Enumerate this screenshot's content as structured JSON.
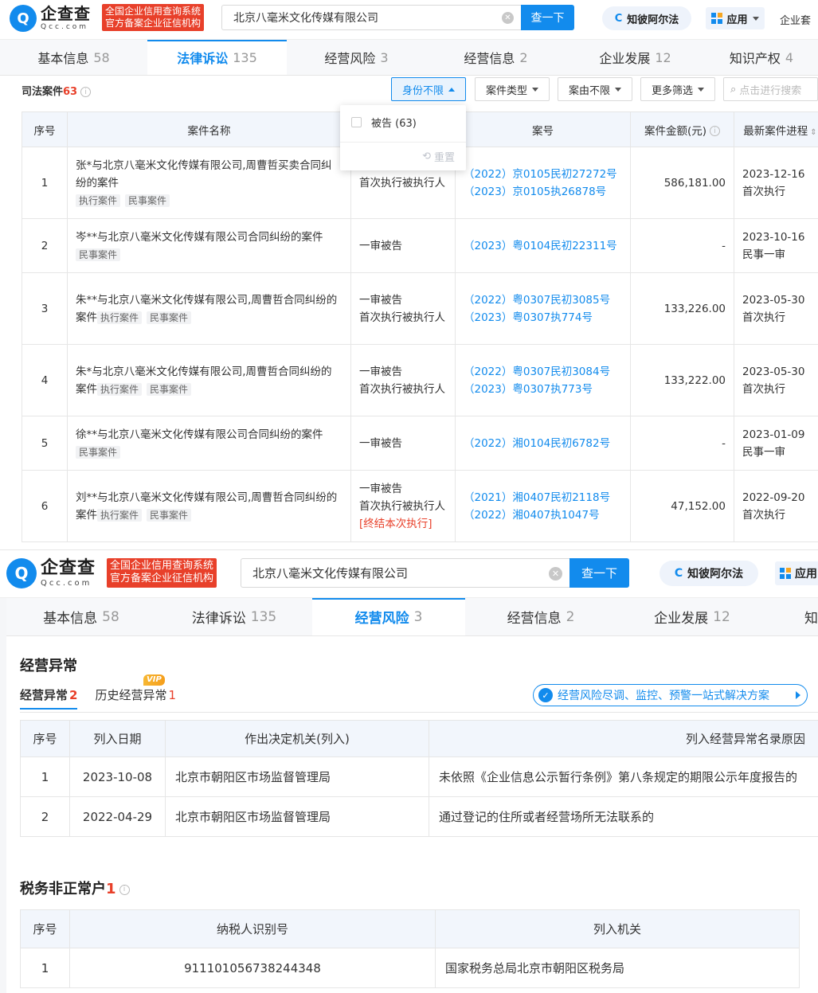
{
  "header": {
    "logo_cn": "企查查",
    "logo_en": "Qcc.com",
    "badge_line1": "全国企业信用查询系统",
    "badge_line2": "官方备案企业征信机构",
    "search_value": "北京八毫米文化传媒有限公司",
    "search_button": "查一下",
    "assistant_label": "知彼阿尔法",
    "app_label": "应用",
    "more_label": "企业套"
  },
  "tabs1": [
    {
      "label": "基本信息",
      "count": "58"
    },
    {
      "label": "法律诉讼",
      "count": "135"
    },
    {
      "label": "经营风险",
      "count": "3"
    },
    {
      "label": "经营信息",
      "count": "2"
    },
    {
      "label": "企业发展",
      "count": "12"
    },
    {
      "label": "知识产权",
      "count": "4"
    }
  ],
  "tabs2": [
    {
      "label": "基本信息",
      "count": "58"
    },
    {
      "label": "法律诉讼",
      "count": "135"
    },
    {
      "label": "经营风险",
      "count": "3"
    },
    {
      "label": "经营信息",
      "count": "2"
    },
    {
      "label": "企业发展",
      "count": "12"
    },
    {
      "label": "知",
      "count": ""
    }
  ],
  "judicial": {
    "title": "司法案件",
    "count": "63",
    "filters": [
      "身份不限",
      "案件类型",
      "案由不限",
      "更多筛选"
    ],
    "search_placeholder": "点击进行搜索",
    "popup": {
      "option": "被告 (63)",
      "reset": "重置"
    },
    "columns": [
      "序号",
      "案件名称",
      "",
      "案号",
      "案件金额(元)",
      "最新案件进程"
    ],
    "rows": [
      {
        "no": "1",
        "name": "张*与北京八毫米文化传媒有限公司,周曹哲买卖合同纠纷的案件",
        "tags": [
          "执行案件",
          "民事案件"
        ],
        "roles": [
          "",
          "首次执行被执行人"
        ],
        "role_note": "",
        "case_nos": [
          "（2022）京0105民初27272号",
          "（2023）京0105执26878号"
        ],
        "amount": "586,181.00",
        "date": "2023-12-16",
        "stage": "首次执行"
      },
      {
        "no": "2",
        "name": "岑**与北京八毫米文化传媒有限公司合同纠纷的案件",
        "tags": [
          "民事案件"
        ],
        "roles": [
          "一审被告"
        ],
        "role_note": "",
        "case_nos": [
          "（2023）粤0104民初22311号"
        ],
        "amount": "-",
        "date": "2023-10-16",
        "stage": "民事一审"
      },
      {
        "no": "3",
        "name": "朱**与北京八毫米文化传媒有限公司,周曹哲合同纠纷的案件",
        "tags": [
          "执行案件",
          "民事案件"
        ],
        "roles": [
          "一审被告",
          "首次执行被执行人"
        ],
        "role_note": "",
        "case_nos": [
          "（2022）粤0307民初3085号",
          "（2023）粤0307执774号"
        ],
        "amount": "133,226.00",
        "date": "2023-05-30",
        "stage": "首次执行"
      },
      {
        "no": "4",
        "name": "朱*与北京八毫米文化传媒有限公司,周曹哲合同纠纷的案件",
        "tags": [
          "执行案件",
          "民事案件"
        ],
        "roles": [
          "一审被告",
          "首次执行被执行人"
        ],
        "role_note": "",
        "case_nos": [
          "（2022）粤0307民初3084号",
          "（2023）粤0307执773号"
        ],
        "amount": "133,222.00",
        "date": "2023-05-30",
        "stage": "首次执行"
      },
      {
        "no": "5",
        "name": "徐**与北京八毫米文化传媒有限公司合同纠纷的案件",
        "tags": [
          "民事案件"
        ],
        "roles": [
          "一审被告"
        ],
        "role_note": "",
        "case_nos": [
          "（2022）湘0104民初6782号"
        ],
        "amount": "-",
        "date": "2023-01-09",
        "stage": "民事一审"
      },
      {
        "no": "6",
        "name": "刘**与北京八毫米文化传媒有限公司,周曹哲合同纠纷的案件",
        "tags": [
          "执行案件",
          "民事案件"
        ],
        "roles": [
          "一审被告",
          "首次执行被执行人"
        ],
        "role_note": "[终结本次执行]",
        "case_nos": [
          "（2021）湘0407民初2118号",
          "（2022）湘0407执1047号"
        ],
        "amount": "47,152.00",
        "date": "2022-09-20",
        "stage": "首次执行"
      }
    ]
  },
  "abnormal": {
    "title": "经营异常",
    "subtabs": [
      {
        "label": "经营异常",
        "count": "2"
      },
      {
        "label": "历史经营异常",
        "count": "1"
      }
    ],
    "vip": "VIP",
    "banner": "经营风险尽调、监控、预警一站式解决方案",
    "columns": [
      "序号",
      "列入日期",
      "作出决定机关(列入)",
      "列入经营异常名录原因"
    ],
    "rows": [
      {
        "no": "1",
        "date": "2023-10-08",
        "authority": "北京市朝阳区市场监督管理局",
        "reason": "未依照《企业信息公示暂行条例》第八条规定的期限公示年度报告的"
      },
      {
        "no": "2",
        "date": "2022-04-29",
        "authority": "北京市朝阳区市场监督管理局",
        "reason": "通过登记的住所或者经营场所无法联系的"
      }
    ]
  },
  "tax": {
    "title": "税务非正常户",
    "count": "1",
    "columns": [
      "序号",
      "纳税人识别号",
      "列入机关"
    ],
    "rows": [
      {
        "no": "1",
        "taxid": "911101056738244348",
        "authority": "国家税务总局北京市朝阳区税务局"
      }
    ]
  },
  "colors": {
    "primary": "#128bed",
    "danger": "#e8402a"
  }
}
